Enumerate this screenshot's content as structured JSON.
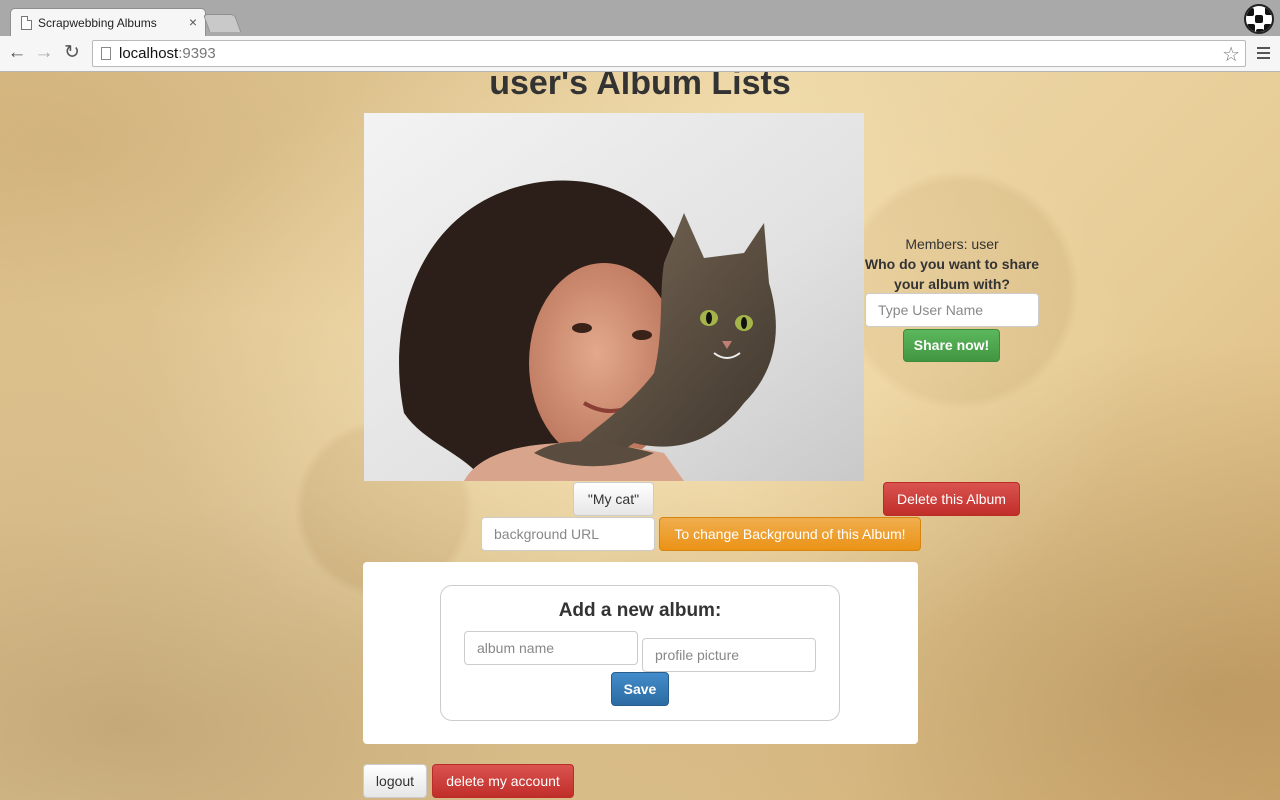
{
  "browser": {
    "tab_title": "Scrapwebbing Albums",
    "tab_close": "×",
    "url_host": "localhost",
    "url_port": ":9393",
    "back_icon": "←",
    "forward_icon": "→",
    "reload_icon": "↻",
    "star_icon": "☆"
  },
  "page": {
    "title": "user's Album Lists",
    "album": {
      "photo_alt": "girl holding a tabby cat",
      "caption": "\"My cat\"",
      "delete_label": "Delete this Album",
      "background_placeholder": "background URL",
      "background_button": "To change Background of this Album!"
    },
    "share": {
      "members": "Members: user",
      "question": "Who do you want to share your album with?",
      "input_placeholder": "Type User Name",
      "button": "Share now!"
    },
    "new_album": {
      "title": "Add a new album:",
      "name_placeholder": "album name",
      "picture_placeholder": "profile picture",
      "save": "Save"
    },
    "account": {
      "logout": "logout",
      "delete": "delete my account"
    }
  },
  "colors": {
    "success": "#5cb85c",
    "danger": "#d9534f",
    "warning": "#f0ad4e",
    "primary": "#428bca"
  }
}
